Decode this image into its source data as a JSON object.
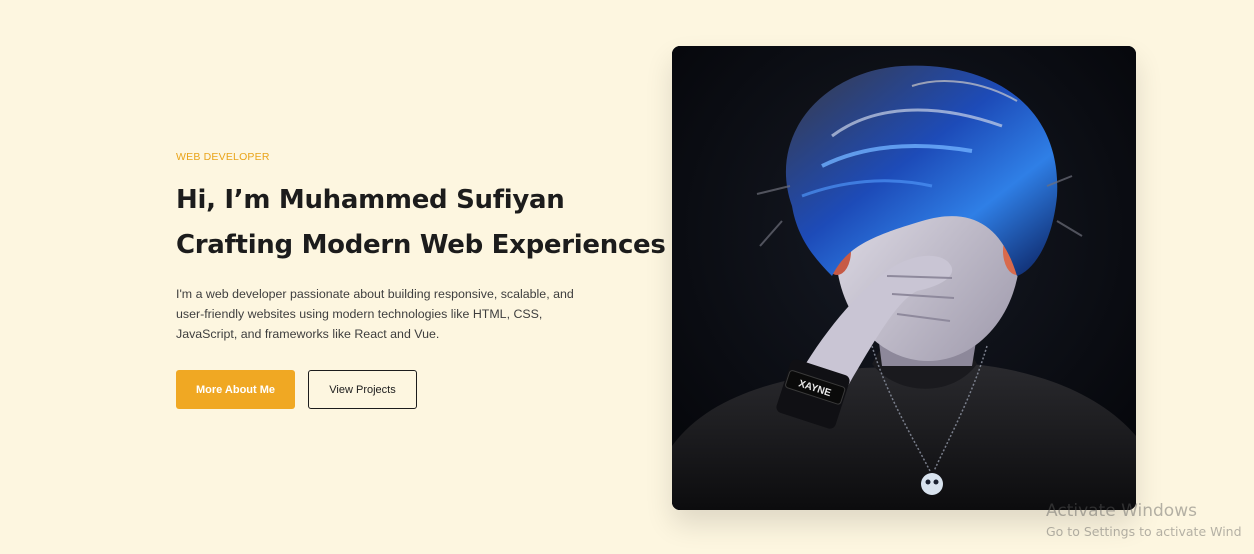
{
  "hero": {
    "eyebrow": "WEB DEVELOPER",
    "headline_line1": "Hi, I’m Muhammed Sufiyan",
    "headline_line2": "Crafting Modern Web Experiences",
    "intro": "I'm a web developer passionate about building responsive, scalable, and user-friendly websites using modern technologies like HTML, CSS, JavaScript, and frameworks like React and Vue.",
    "primary_button": "More About Me",
    "secondary_button": "View Projects"
  },
  "portrait": {
    "wristband_text": "XAYNE"
  },
  "windows_watermark": {
    "title": "Activate Windows",
    "subtitle": "Go to Settings to activate Wind"
  },
  "colors": {
    "background": "#fdf6e0",
    "accent": "#f0a823",
    "text": "#1c1c1c"
  }
}
